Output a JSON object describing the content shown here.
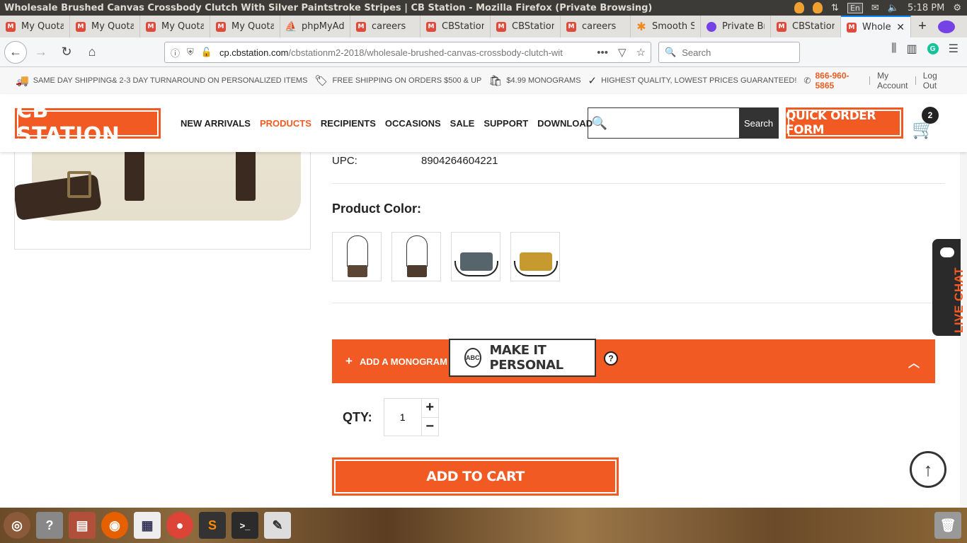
{
  "window": {
    "title": "Wholesale Brushed Canvas Crossbody Clutch With Silver Paintstroke Stripes | CB Station - Mozilla Firefox (Private Browsing)",
    "keyboard": "En",
    "time": "5:18 PM"
  },
  "tabs": [
    {
      "label": "My Quota",
      "icon": "magento-icon"
    },
    {
      "label": "My Quota",
      "icon": "magento-icon"
    },
    {
      "label": "My Quota",
      "icon": "magento-icon"
    },
    {
      "label": "My Quota",
      "icon": "magento-icon"
    },
    {
      "label": "phpMyAd",
      "icon": "phpmyadmin-icon"
    },
    {
      "label": "careers",
      "icon": "magento-icon"
    },
    {
      "label": "CBStation",
      "icon": "magento-icon"
    },
    {
      "label": "CBStation",
      "icon": "magento-icon"
    },
    {
      "label": "careers",
      "icon": "magento-icon"
    },
    {
      "label": "Smooth S",
      "icon": "smooth-icon"
    },
    {
      "label": "Private Br",
      "icon": "private-browsing-icon"
    },
    {
      "label": "CBStation",
      "icon": "magento-icon"
    },
    {
      "label": "Whole",
      "icon": "magento-icon",
      "active": true
    }
  ],
  "navbar": {
    "url_host": "cp.cbstation.com",
    "url_path": "/cbstationm2-2018/wholesale-brushed-canvas-crossbody-clutch-wit",
    "search_placeholder": "Search"
  },
  "promo": {
    "items": [
      {
        "icon": "truck-icon",
        "text": "SAME DAY SHIPPING& 2-3 DAY TURNAROUND ON PERSONALIZED ITEMS"
      },
      {
        "icon": "free-tag-icon",
        "text": "FREE SHIPPING ON ORDERS $500 & UP"
      },
      {
        "icon": "bag-icon",
        "text": "$4.99 MONOGRAMS"
      },
      {
        "icon": "check-circle-icon",
        "text": "HIGHEST QUALITY, LOWEST PRICES GUARANTEED!"
      }
    ],
    "phone": "866-960-5865",
    "my_account": "My Account",
    "log_out": "Log Out"
  },
  "header": {
    "logo": "CB STATION",
    "nav": [
      "NEW ARRIVALS",
      "PRODUCTS",
      "RECIPIENTS",
      "OCCASIONS",
      "SALE",
      "SUPPORT",
      "DOWNLOAD"
    ],
    "search_button": "Search",
    "quick_order": "QUICK ORDER FORM",
    "cart_count": "2",
    "brand_color": "#f15a22"
  },
  "product": {
    "upc_label": "UPC:",
    "upc_value": "8904264604221",
    "color_label": "Product Color:",
    "swatches": [
      {
        "name": "brown-strap-pouch",
        "color": "#5b4535"
      },
      {
        "name": "dark-brown-strap-pouch",
        "color": "#4d3c2e"
      },
      {
        "name": "slate-blue-clutch",
        "color": "#56646b"
      },
      {
        "name": "mustard-clutch",
        "color": "#c79a2f"
      }
    ],
    "monogram_label": "ADD A MONOGRAM",
    "make_it_personal": "MAKE IT PERSONAL",
    "monogram_badge": "ABC",
    "qty_label": "QTY:",
    "qty_value": "1",
    "add_to_cart": "ADD TO CART",
    "live_chat": "LIVE CHAT"
  }
}
